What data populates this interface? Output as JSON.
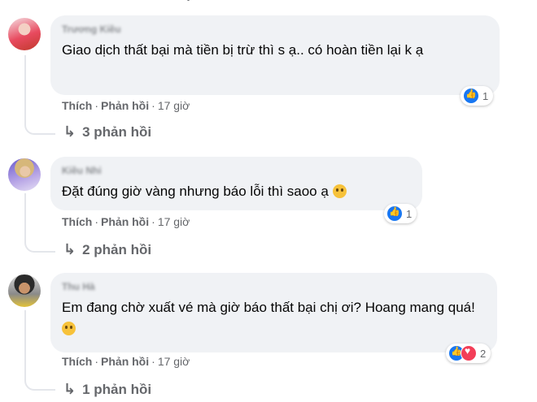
{
  "comments": [
    {
      "author": "Trương Kiều",
      "text": "Giao dịch thất bại mà tiền bị trừ thì s ạ.. có hoàn tiền lại k ạ",
      "emoji": "",
      "like_label": "Thích",
      "reply_label": "Phản hồi",
      "time": "17 giờ",
      "reaction_count": "1",
      "replies": "3 phản hồi"
    },
    {
      "author": "Kiều Nhi",
      "text": "Đặt đúng giờ vàng nhưng báo lỗi thì saoo ạ",
      "emoji": "sad-face",
      "like_label": "Thích",
      "reply_label": "Phản hồi",
      "time": "17 giờ",
      "reaction_count": "1",
      "replies": "2 phản hồi"
    },
    {
      "author": "Thu Hà",
      "text": "Em đang chờ xuất vé mà giờ báo thất bại chị ơi? Hoang mang quá!",
      "emoji": "pleading-face",
      "like_label": "Thích",
      "reply_label": "Phản hồi",
      "time": "17 giờ",
      "reaction_count": "2",
      "replies": "1 phản hồi"
    }
  ],
  "separator": "·",
  "reply_icon": "↳",
  "colors": {
    "bubble": "#f0f2f5",
    "like": "#1877f2",
    "love": "#f33e58",
    "meta": "#65676b"
  }
}
